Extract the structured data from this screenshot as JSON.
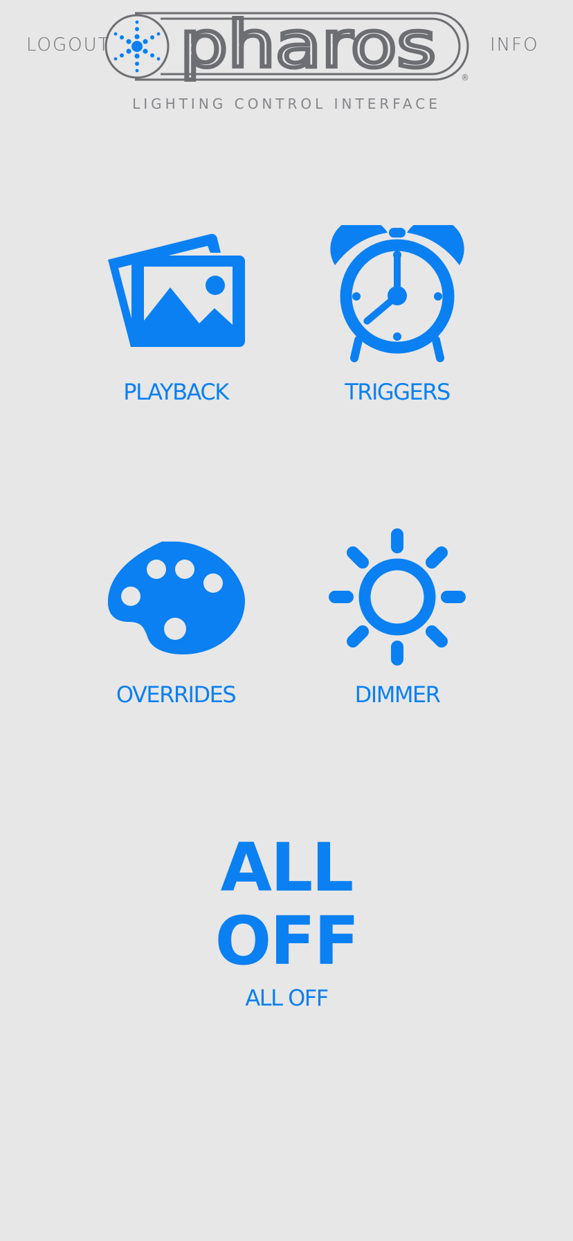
{
  "header": {
    "logout_label": "LOGOUT",
    "info_label": "INFO",
    "logo_text": "pharos",
    "registered_mark": "®",
    "subtitle": "LIGHTING CONTROL INTERFACE"
  },
  "tiles": [
    {
      "label": "PLAYBACK",
      "icon": "photos-icon"
    },
    {
      "label": "TRIGGERS",
      "icon": "alarm-clock-icon"
    },
    {
      "label": "OVERRIDES",
      "icon": "palette-icon"
    },
    {
      "label": "DIMMER",
      "icon": "sun-icon"
    }
  ],
  "all_off": {
    "big_line1": "ALL",
    "big_line2": "OFF",
    "label": "ALL OFF"
  },
  "colors": {
    "background": "#e7e7e8",
    "accent": "#0a80f2",
    "header_text": "#6d6e71"
  }
}
